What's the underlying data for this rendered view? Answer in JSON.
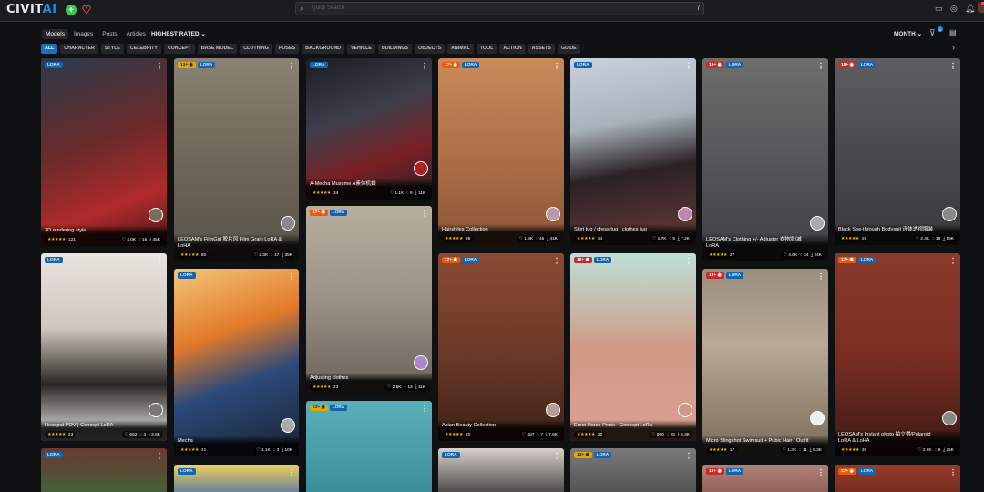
{
  "header": {
    "logo_part1": "CIVIT",
    "logo_part2": "AI",
    "search_placeholder": "Quick Search",
    "search_shortcut": "/"
  },
  "topnav": {
    "tabs": [
      "Models",
      "Images",
      "Posts",
      "Articles"
    ],
    "active": "Models",
    "sort_label": "HIGHEST RATED",
    "period_label": "MONTH",
    "filter_count": "1"
  },
  "categories": [
    "ALL",
    "CHARACTER",
    "STYLE",
    "CELEBRITY",
    "CONCEPT",
    "BASE MODEL",
    "CLOTHING",
    "POSES",
    "BACKGROUND",
    "VEHICLE",
    "BUILDINGS",
    "OBJECTS",
    "ANIMAL",
    "TOOL",
    "ACTION",
    "ASSETS",
    "GUIDE"
  ],
  "active_category": "ALL",
  "colors": {
    "accent": "#1971c2",
    "star": "#fab005",
    "bg": "#101113"
  },
  "cards": [
    {
      "title": "3D rendering style",
      "rating_count": "121",
      "likes": "4.0K",
      "comments": "16",
      "downloads": "45K",
      "nsfw": "",
      "type": "LORA"
    },
    {
      "title": "LEOSAM's FilmGirl 胶片风 Film Grain LoRA & LoHA",
      "rating_count": "60",
      "likes": "2.3K",
      "comments": "17",
      "downloads": "35K",
      "nsfw": "13+",
      "type": "LORA"
    },
    {
      "title": "A-Mecha Musume A素体机娘",
      "rating_count": "34",
      "likes": "1.1K",
      "comments": "8",
      "downloads": "11K",
      "nsfw": "",
      "type": "LORA"
    },
    {
      "title": "Hairstyles Collection",
      "rating_count": "36",
      "likes": "1.3K",
      "comments": "45",
      "downloads": "41K",
      "nsfw": "17+",
      "type": "LORA"
    },
    {
      "title": "Skirt tug / dress tug / clothes tug",
      "rating_count": "24",
      "likes": "1.7K",
      "comments": "9",
      "downloads": "7.2K",
      "nsfw": "",
      "type": "LORA"
    },
    {
      "title": "LEOSAM's Clothing +/- Adjuster 衣物增/减 LoRA",
      "rating_count": "27",
      "likes": "4.6K",
      "comments": "34",
      "downloads": "24K",
      "nsfw": "18+",
      "type": "LORA"
    },
    {
      "title": "Black See-through Bodysuit 连体透视服装",
      "rating_count": "26",
      "likes": "2.4K",
      "comments": "18",
      "downloads": "18K",
      "nsfw": "18+",
      "type": "LORA"
    },
    {
      "title": "Headpat POV | Concept LoRA",
      "rating_count": "23",
      "likes": "652",
      "comments": "4",
      "downloads": "3.8K",
      "nsfw": "",
      "type": "LORA"
    },
    {
      "title": "Mecha",
      "rating_count": "21",
      "likes": "1.1K",
      "comments": "3",
      "downloads": "10K",
      "nsfw": "",
      "type": "LORA"
    },
    {
      "title": "Adjusting clothes",
      "rating_count": "23",
      "likes": "2.5K",
      "comments": "13",
      "downloads": "11K",
      "nsfw": "17+",
      "type": "LORA"
    },
    {
      "title": "Asian Beauty Collection",
      "rating_count": "20",
      "likes": "487",
      "comments": "7",
      "downloads": "7.6K",
      "nsfw": "17+",
      "type": "LORA"
    },
    {
      "title": "Erect Horse Penis - Concept LoRA",
      "rating_count": "20",
      "likes": "560",
      "comments": "25",
      "downloads": "5.3K",
      "nsfw": "18+",
      "type": "LORA"
    },
    {
      "title": "Micro Slingshot Swimsuit + Pubic Hair / Outfit",
      "rating_count": "17",
      "likes": "1.3K",
      "comments": "11",
      "downloads": "5.3K",
      "nsfw": "18+",
      "type": "LORA"
    },
    {
      "title": "LEOSAM's Instant photo 拍立得/Polaroid LoRA & LoHA",
      "rating_count": "39",
      "likes": "2.8K",
      "comments": "9",
      "downloads": "25K",
      "nsfw": "17+",
      "type": "LORA"
    },
    {
      "title": "",
      "nsfw": "",
      "type": "LORA"
    },
    {
      "title": "",
      "nsfw": "",
      "type": "LORA"
    },
    {
      "title": "",
      "nsfw": "13+",
      "type": "LORA"
    },
    {
      "title": "",
      "nsfw": "",
      "type": "LORA"
    },
    {
      "title": "",
      "nsfw": "13+",
      "type": "LORA"
    },
    {
      "title": "",
      "nsfw": "18+",
      "type": "LORA"
    },
    {
      "title": "",
      "nsfw": "17+",
      "type": "LORA"
    }
  ]
}
